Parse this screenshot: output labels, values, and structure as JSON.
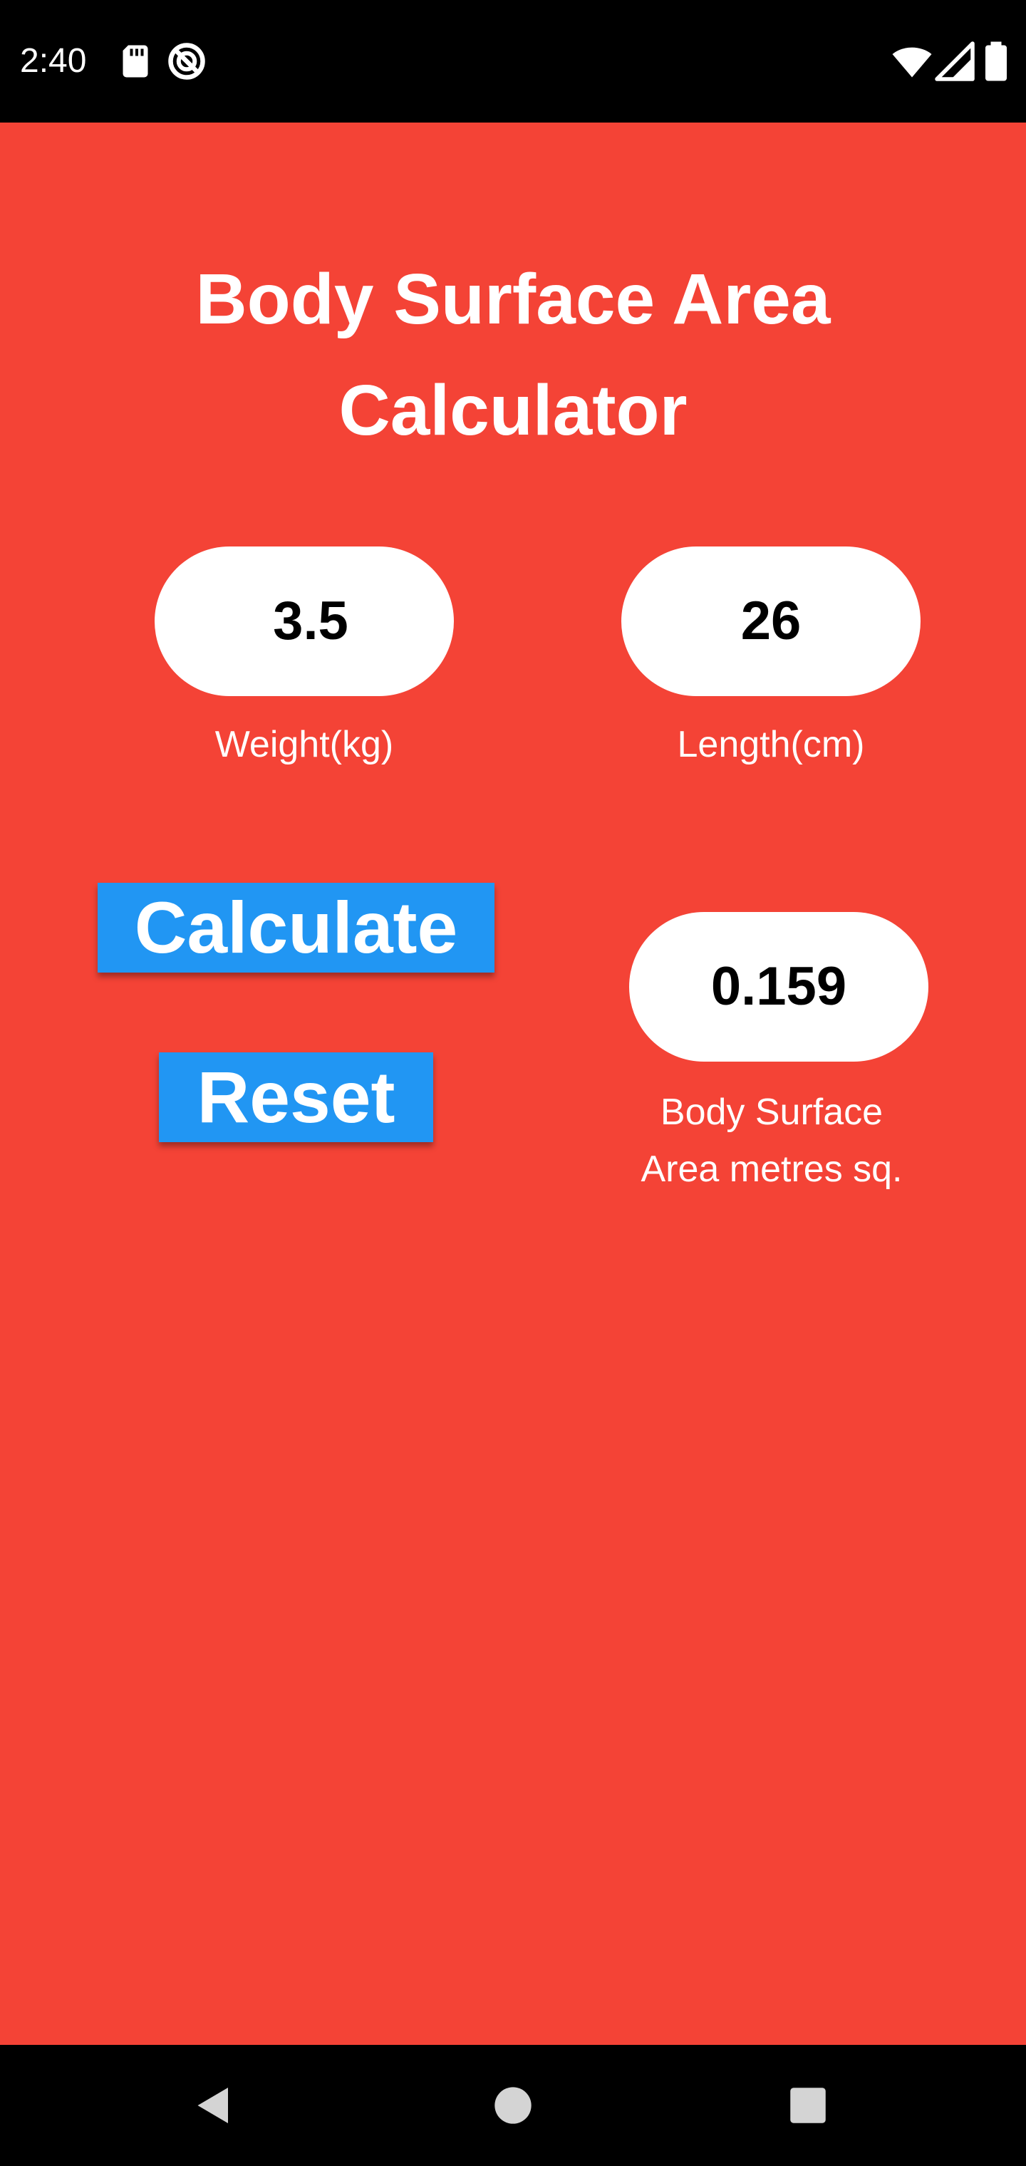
{
  "status_bar": {
    "time": "2:40",
    "icons": [
      "sd-card-icon",
      "do-not-disturb-icon",
      "wifi-icon",
      "cell-signal-icon",
      "battery-icon"
    ]
  },
  "title": {
    "line1": "Body Surface Area",
    "line2": "Calculator"
  },
  "weight": {
    "value": "3.5",
    "label": "Weight(kg)"
  },
  "length": {
    "value": "26",
    "label": "Length(cm)"
  },
  "result": {
    "value": "0.159",
    "label_line1": "Body Surface",
    "label_line2": "Area metres sq."
  },
  "buttons": {
    "calculate": "Calculate",
    "reset": "Reset"
  },
  "nav": {
    "icons": [
      "back-icon",
      "home-icon",
      "recents-icon"
    ]
  },
  "colors": {
    "background": "#f44336",
    "button": "#2196f3",
    "field": "#ffffff",
    "system_bars": "#000000"
  }
}
